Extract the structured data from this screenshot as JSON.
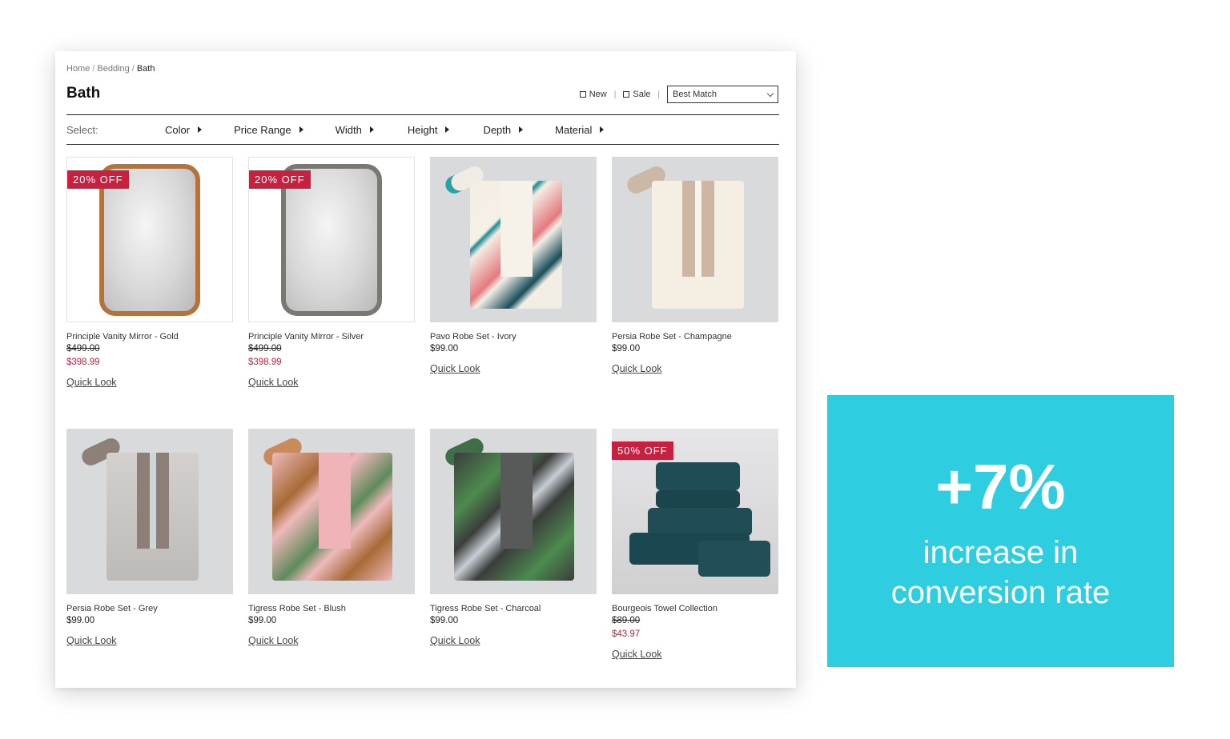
{
  "breadcrumb": [
    "Home",
    "Bedding",
    "Bath"
  ],
  "page_title": "Bath",
  "toolbar": {
    "checkbox_new": "New",
    "checkbox_sale": "Sale",
    "sort_selected": "Best Match"
  },
  "filters": {
    "label": "Select:",
    "items": [
      "Color",
      "Price Range",
      "Width",
      "Height",
      "Depth",
      "Material"
    ]
  },
  "quick_look_label": "Quick Look",
  "products": [
    {
      "name": "Principle Vanity Mirror - Gold",
      "badge": "20% OFF",
      "was_price": "$499.00",
      "price": "$398.99"
    },
    {
      "name": "Principle Vanity Mirror - Silver",
      "badge": "20% OFF",
      "was_price": "$499.00",
      "price": "$398.99"
    },
    {
      "name": "Pavo Robe Set - Ivory",
      "price": "$99.00"
    },
    {
      "name": "Persia Robe Set - Champagne",
      "price": "$99.00"
    },
    {
      "name": "Persia Robe Set - Grey",
      "price": "$99.00"
    },
    {
      "name": "Tigress Robe Set - Blush",
      "price": "$99.00"
    },
    {
      "name": "Tigress Robe Set - Charcoal",
      "price": "$99.00"
    },
    {
      "name": "Bourgeois Towel Collection",
      "badge": "50% OFF",
      "was_price": "$89.00",
      "price": "$43.97"
    }
  ],
  "stat": {
    "value": "+7%",
    "caption_line1": "increase in",
    "caption_line2": "conversion rate"
  },
  "colors": {
    "sale_red": "#c8203f",
    "stat_cyan": "#2ecde0"
  }
}
